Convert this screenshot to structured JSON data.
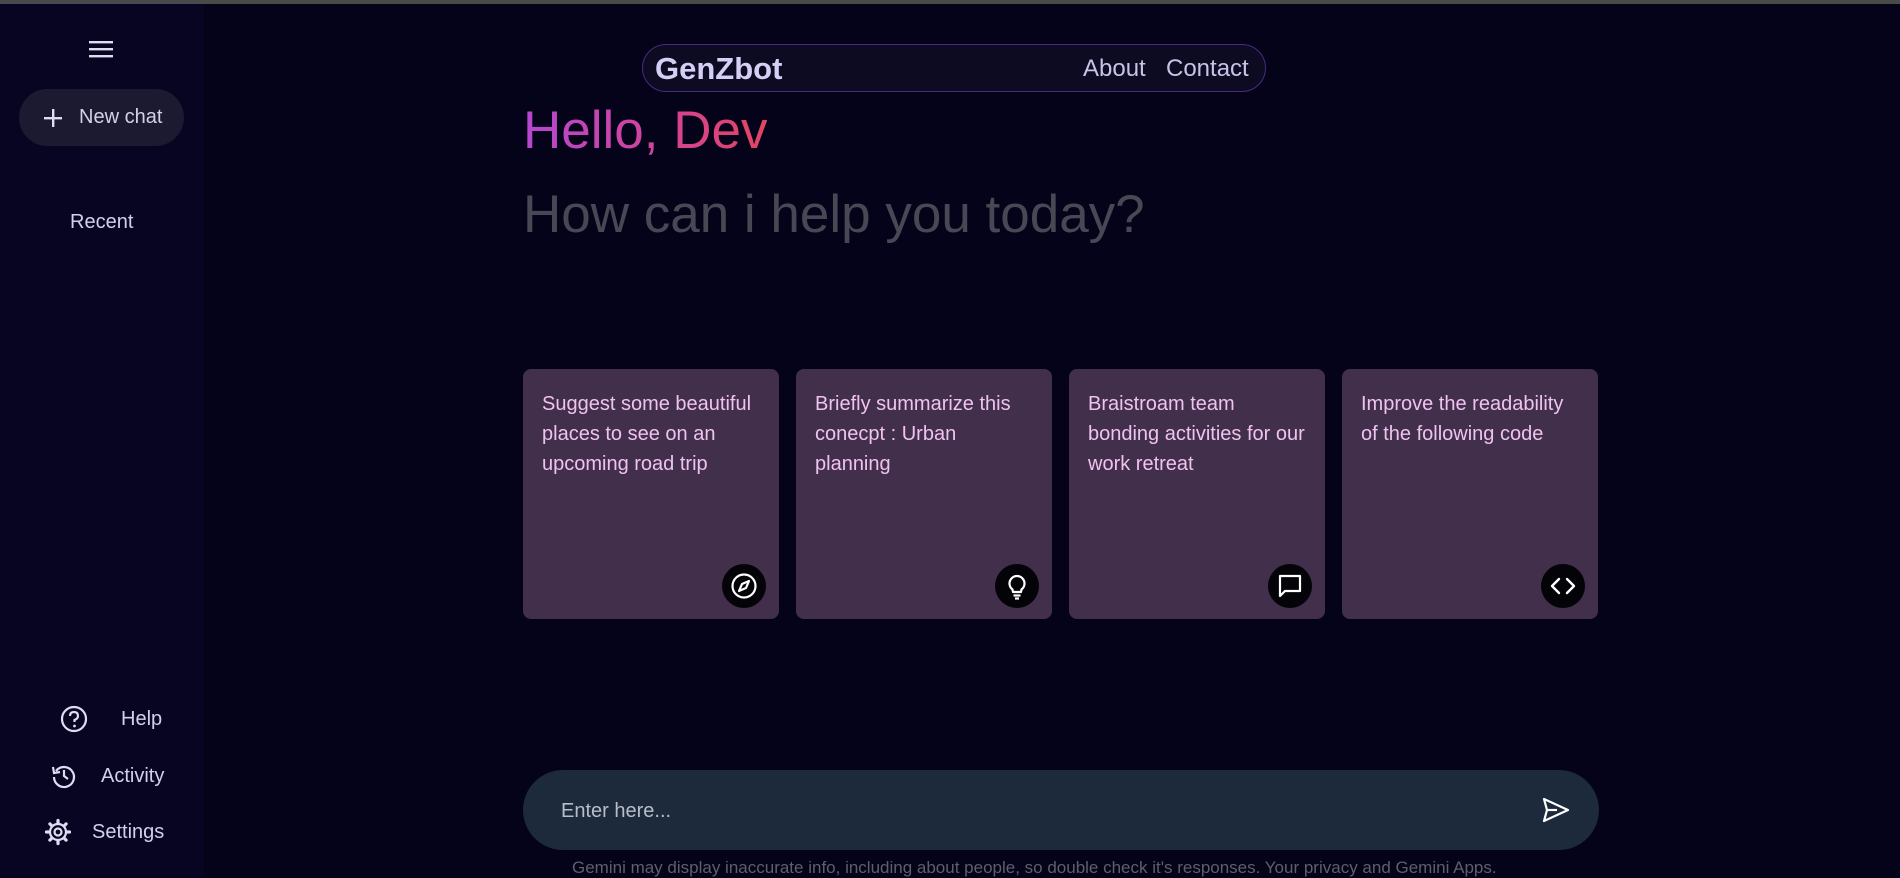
{
  "sidebar": {
    "menu_icon": "menu-icon",
    "new_chat_label": "New chat",
    "recent_label": "Recent",
    "bottom_items": [
      {
        "label": "Help",
        "icon": "help-icon"
      },
      {
        "label": "Activity",
        "icon": "history-icon"
      },
      {
        "label": "Settings",
        "icon": "gear-icon"
      }
    ]
  },
  "navbar": {
    "brand": "GenZbot",
    "links": [
      "About",
      "Contact"
    ]
  },
  "greeting": {
    "hello": "Hello, Dev",
    "subtitle": "How can i help you today?"
  },
  "cards": [
    {
      "text": "Suggest some beautiful places to see on an upcoming road trip",
      "icon": "compass-icon"
    },
    {
      "text": "Briefly summarize this conecpt : Urban planning",
      "icon": "bulb-icon"
    },
    {
      "text": "Braistroam team bonding activities for our work retreat",
      "icon": "message-icon"
    },
    {
      "text": "Improve the readability of the following code",
      "icon": "code-icon"
    }
  ],
  "input": {
    "placeholder": "Enter here...",
    "value": ""
  },
  "footer": "Gemini may display inaccurate info, including about people, so double check it's responses. Your privacy and Gemini Apps.",
  "colors": {
    "background": "#05031a",
    "sidebar": "#070522",
    "card": "#412f4b",
    "card_text": "#f0c2f0",
    "input": "#1c2a3b",
    "gradient_start": "#b547d0",
    "gradient_end": "#e24562"
  }
}
